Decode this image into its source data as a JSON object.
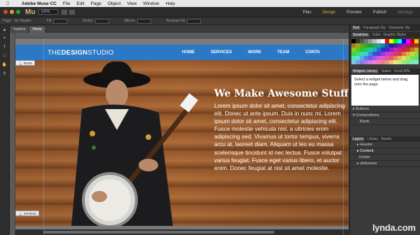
{
  "menubar": {
    "app": "Adobe Muse CC",
    "items": [
      "File",
      "Edit",
      "Page",
      "Object",
      "View",
      "Window",
      "Help"
    ]
  },
  "titlebar": {
    "logo": "Mu",
    "zoom": "100%",
    "modes": [
      "Plan",
      "Design",
      "Preview",
      "Publish",
      "Manage"
    ]
  },
  "controlbar": {
    "page_label": "Page:",
    "page_value": "for Header",
    "fill": "Fill",
    "stroke": "Stroke",
    "effects": "Effects",
    "browser_fill": "Browser Fill"
  },
  "tabs": [
    "*explore",
    "Home"
  ],
  "site": {
    "logo_light": "THE",
    "logo_bold": "DESIGN",
    "logo_rest": "STUDIO",
    "nav": [
      "HOME",
      "SERVICES",
      "WORK",
      "TEAM",
      "CONTA"
    ],
    "hero_title": "We Make Awesome Stuff",
    "hero_body": "Lorem ipsum dolor sit amet, consectetur adipiscing elit. Donec ut ante ipsum. Duis in nunc mi. Lorem ipsum dolor sit amet, consectetur adipiscing elit. Fusce molestie vehicula nisl, a ultricies enim adipiscing sed. Vivamus ut tortor tempus, viverra arcu at, laoreet diam. Aliquam ut leo eu massa scelerisque tincidunt id nec lectus. Fusce volutpat varius feugiat. Fusce eget varius libero, et auctor enim. Donec feugiat at nisl sit amet molestie."
  },
  "anchors": {
    "home": "home",
    "services": "services"
  },
  "panels": {
    "top_tabs": [
      "Text",
      "Paragraph Sty",
      "Character Sty"
    ],
    "swatch_tabs": [
      "Swatches",
      "Color",
      "Graphic Styles"
    ],
    "widget_tabs": [
      "Widgets Library",
      "States",
      "Scroll Effe"
    ],
    "widget_help": "Select a widget below and drag onto the page.",
    "widget_list": [
      "Buttons",
      "Compositions",
      "Blank"
    ],
    "layer_tabs": [
      "Layers",
      "Library",
      "Assets"
    ],
    "layers": [
      "Header",
      "Content",
      "Footer",
      "slideshow"
    ]
  },
  "watermark": "lynda.com",
  "colors": {
    "accent": "#f0a040",
    "nav_blue": "#2a78c6"
  }
}
